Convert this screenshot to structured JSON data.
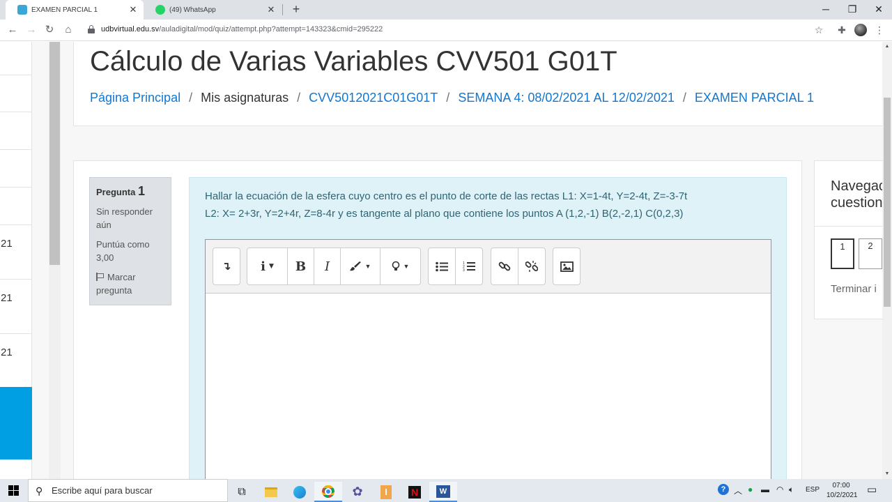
{
  "browser": {
    "tabs": [
      {
        "title": "EXAMEN PARCIAL 1",
        "active": true
      },
      {
        "title": "(49) WhatsApp",
        "active": false
      }
    ],
    "url_host": "udbvirtual.edu.sv",
    "url_path": "/auladigital/mod/quiz/attempt.php?attempt=143323&cmid=295222"
  },
  "drawer": {
    "row_labels": [
      "21",
      "21",
      "21"
    ]
  },
  "page": {
    "course_title": "Cálculo de Varias Variables CVV501 G01T",
    "breadcrumb": [
      "Página Principal",
      "Mis asignaturas",
      "CVV5012021C01G01T",
      "SEMANA 4: 08/02/2021 AL 12/02/2021",
      "EXAMEN PARCIAL 1"
    ]
  },
  "question": {
    "label": "Pregunta",
    "number": "1",
    "status": "Sin responder aún",
    "mark": "Puntúa como 3,00",
    "flag": "Marcar pregunta",
    "text_line1": "Hallar la ecuación de la esfera cuyo centro es el punto de corte de las rectas L1: X=1-4t,  Y=2-4t,  Z=-3-7t",
    "text_line2": "L2: X= 2+3r,  Y=2+4r,  Z=8-4r   y es tangente al plano que contiene los puntos A (1,2,-1) B(2,-2,1) C(0,2,3)"
  },
  "editor": {
    "toolbar_icons": [
      "toggle-toolbar-icon",
      "info-dropdown-icon",
      "bold-icon",
      "italic-icon",
      "paintbrush-icon",
      "lightbulb-icon",
      "bullet-list-icon",
      "numbered-list-icon",
      "link-icon",
      "unlink-icon",
      "image-icon"
    ],
    "bold_glyph": "B",
    "italic_glyph": "I"
  },
  "quiz_nav": {
    "title_line1": "Navegac",
    "title_line2": "cuestion",
    "buttons": [
      "1",
      "2"
    ],
    "finish": "Terminar i"
  },
  "taskbar": {
    "search_placeholder": "Escribe aquí para buscar",
    "language": "ESP",
    "time": "07:00",
    "date": "10/2/2021"
  },
  "colors": {
    "accent_link": "#1177d1",
    "drawer_active": "#009fe3",
    "question_bg": "#def2f8",
    "question_text": "#2f6473"
  }
}
